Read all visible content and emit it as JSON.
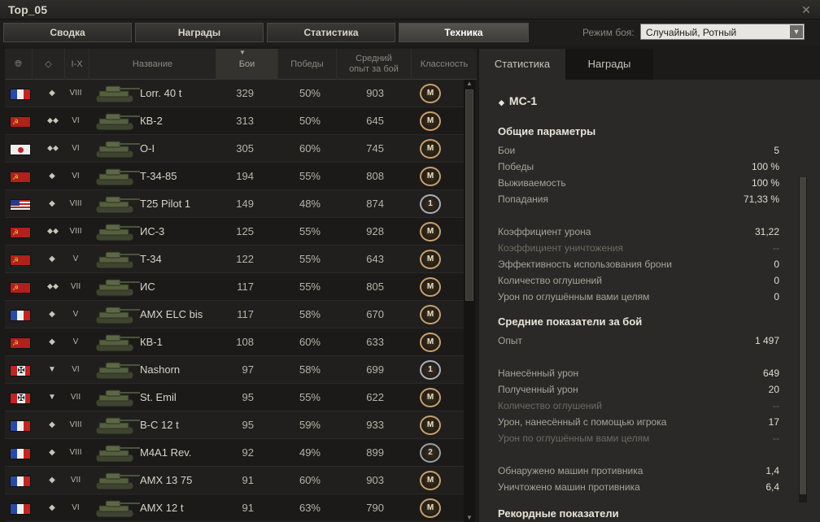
{
  "window": {
    "title": "Top_05",
    "close_icon": "close-icon"
  },
  "tabs": [
    {
      "label": "Сводка",
      "active": false
    },
    {
      "label": "Награды",
      "active": false
    },
    {
      "label": "Статистика",
      "active": false
    },
    {
      "label": "Техника",
      "active": true
    }
  ],
  "mode": {
    "label": "Режим боя:",
    "value": "Случайный, Ротный"
  },
  "columns": {
    "nation_icon": "globe-icon",
    "type_icon": "vehicle-type-icon",
    "tier": "I-X",
    "name": "Название",
    "battles": "Бои",
    "wins": "Победы",
    "avg_xp": "Средний опыт за бой",
    "mastery": "Классность"
  },
  "vehicles": [
    {
      "nation": "fr",
      "type": "◆",
      "tier": "VIII",
      "name": "Lorr. 40 t",
      "battles": "329",
      "wins": "50%",
      "xp": "903",
      "mastery": "M"
    },
    {
      "nation": "ussr",
      "type": "⬥⬥",
      "tier": "VI",
      "name": "КВ-2",
      "battles": "313",
      "wins": "50%",
      "xp": "645",
      "mastery": "M"
    },
    {
      "nation": "jp",
      "type": "⬥⬥",
      "tier": "VI",
      "name": "O-I",
      "battles": "305",
      "wins": "60%",
      "xp": "745",
      "mastery": "M"
    },
    {
      "nation": "ussr",
      "type": "◆",
      "tier": "VI",
      "name": "Т-34-85",
      "battles": "194",
      "wins": "55%",
      "xp": "808",
      "mastery": "M"
    },
    {
      "nation": "us",
      "type": "◆",
      "tier": "VIII",
      "name": "T25 Pilot 1",
      "battles": "149",
      "wins": "48%",
      "xp": "874",
      "mastery": "1"
    },
    {
      "nation": "ussr",
      "type": "⬥⬥",
      "tier": "VIII",
      "name": "ИС-3",
      "battles": "125",
      "wins": "55%",
      "xp": "928",
      "mastery": "M"
    },
    {
      "nation": "ussr",
      "type": "◆",
      "tier": "V",
      "name": "Т-34",
      "battles": "122",
      "wins": "55%",
      "xp": "643",
      "mastery": "M"
    },
    {
      "nation": "ussr",
      "type": "⬥⬥",
      "tier": "VII",
      "name": "ИС",
      "battles": "117",
      "wins": "55%",
      "xp": "805",
      "mastery": "M"
    },
    {
      "nation": "fr",
      "type": "◆",
      "tier": "V",
      "name": "AMX ELC bis",
      "battles": "117",
      "wins": "58%",
      "xp": "670",
      "mastery": "M"
    },
    {
      "nation": "ussr",
      "type": "◆",
      "tier": "V",
      "name": "КВ-1",
      "battles": "108",
      "wins": "60%",
      "xp": "633",
      "mastery": "M"
    },
    {
      "nation": "de",
      "type": "▼",
      "tier": "VI",
      "name": "Nashorn",
      "battles": "97",
      "wins": "58%",
      "xp": "699",
      "mastery": "1"
    },
    {
      "nation": "de",
      "type": "▼",
      "tier": "VII",
      "name": "St. Emil",
      "battles": "95",
      "wins": "55%",
      "xp": "622",
      "mastery": "M"
    },
    {
      "nation": "fr",
      "type": "◆",
      "tier": "VIII",
      "name": "B-C 12 t",
      "battles": "95",
      "wins": "59%",
      "xp": "933",
      "mastery": "M"
    },
    {
      "nation": "fr",
      "type": "◆",
      "tier": "VIII",
      "name": "M4A1 Rev.",
      "battles": "92",
      "wins": "49%",
      "xp": "899",
      "mastery": "2"
    },
    {
      "nation": "fr",
      "type": "◆",
      "tier": "VII",
      "name": "AMX 13 75",
      "battles": "91",
      "wins": "60%",
      "xp": "903",
      "mastery": "M"
    },
    {
      "nation": "fr",
      "type": "◆",
      "tier": "VI",
      "name": "AMX 12 t",
      "battles": "91",
      "wins": "63%",
      "xp": "790",
      "mastery": "M"
    }
  ],
  "right_tabs": [
    {
      "label": "Статистика",
      "active": true
    },
    {
      "label": "Награды",
      "active": false
    }
  ],
  "detail": {
    "tank": "МС-1",
    "tank_icon": "light-tank-icon",
    "sections": [
      {
        "title": "Общие параметры"
      },
      {
        "title": "Средние показатели за бой"
      },
      {
        "title": "Рекордные показатели"
      }
    ],
    "lines": [
      {
        "label": "Бои",
        "value": "5",
        "dim": false
      },
      {
        "label": "Победы",
        "value": "100 %",
        "dim": false
      },
      {
        "label": "Выживаемость",
        "value": "100 %",
        "dim": false
      },
      {
        "label": "Попадания",
        "value": "71,33 %",
        "dim": false
      },
      {
        "label": "Коэффициент урона",
        "value": "31,22",
        "dim": false
      },
      {
        "label": "Коэффициент уничтожения",
        "value": "--",
        "dim": true
      },
      {
        "label": "Эффективность использования брони",
        "value": "0",
        "dim": false
      },
      {
        "label": "Количество оглушений",
        "value": "0",
        "dim": false
      },
      {
        "label": "Урон по оглушённым вами целям",
        "value": "0",
        "dim": false
      },
      {
        "label": "Опыт",
        "value": "1 497",
        "dim": false
      },
      {
        "label": "Нанесённый урон",
        "value": "649",
        "dim": false
      },
      {
        "label": "Полученный урон",
        "value": "20",
        "dim": false
      },
      {
        "label": "Количество оглушений",
        "value": "--",
        "dim": true
      },
      {
        "label": "Урон, нанесённый с помощью игрока",
        "value": "17",
        "dim": false
      },
      {
        "label": "Урон по оглушённым вами целям",
        "value": "--",
        "dim": true
      },
      {
        "label": "Обнаружено машин противника",
        "value": "1,4",
        "dim": false
      },
      {
        "label": "Уничтожено машин противника",
        "value": "6,4",
        "dim": false
      }
    ]
  }
}
